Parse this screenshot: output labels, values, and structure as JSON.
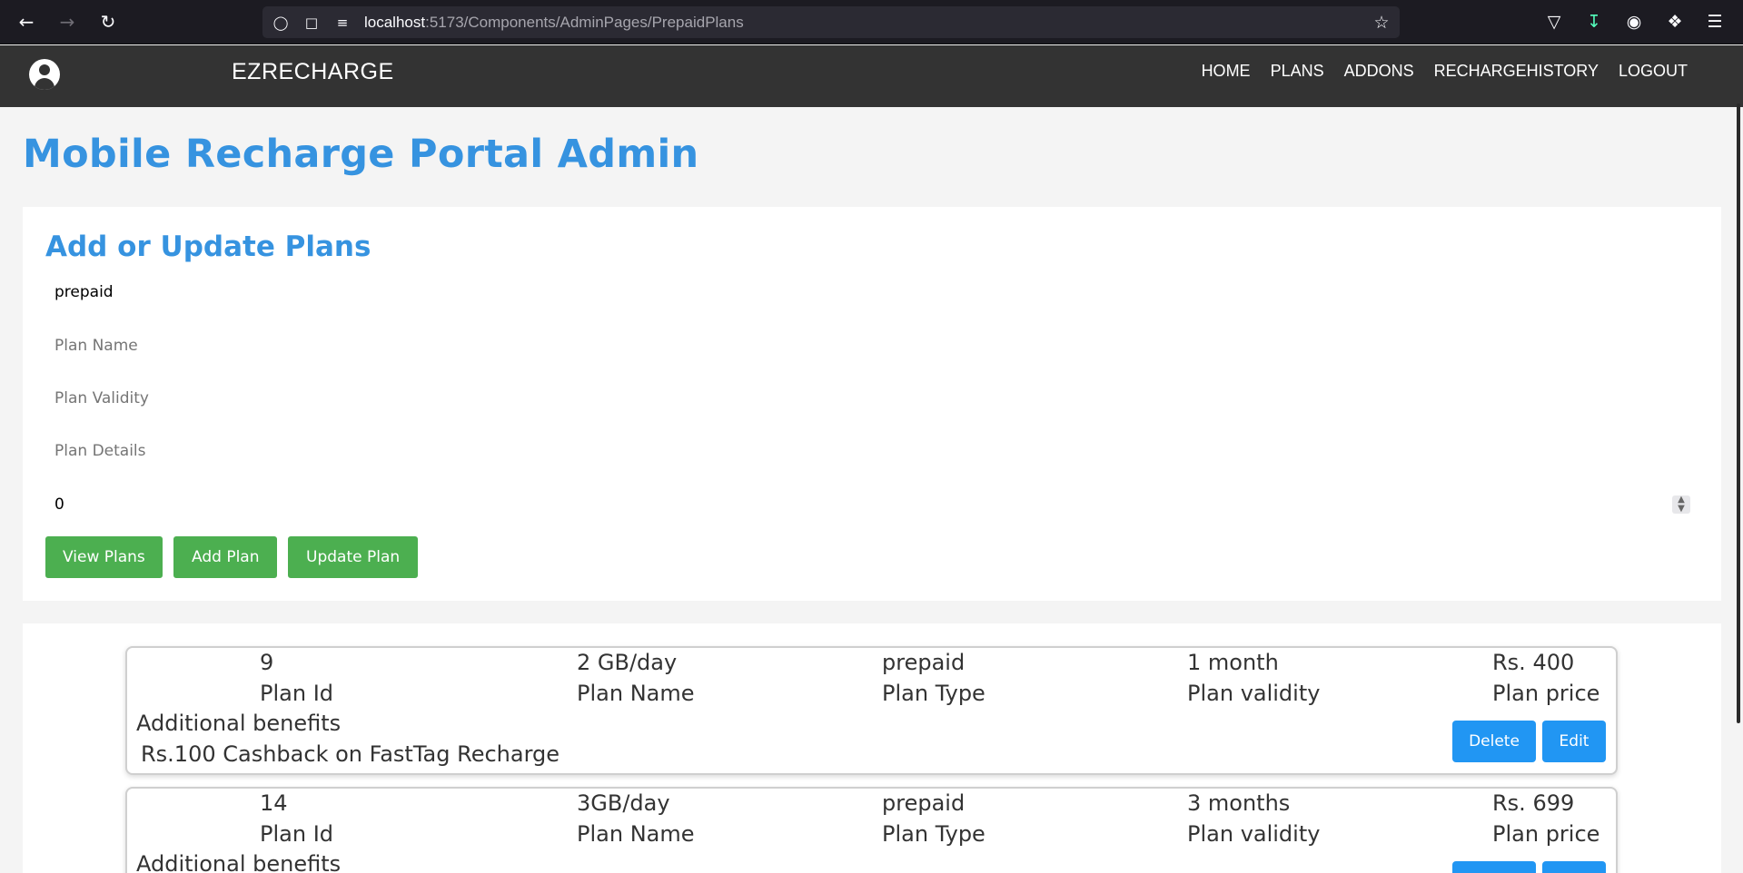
{
  "browser": {
    "url_host": "localhost",
    "url_path": ":5173/Components/AdminPages/PrepaidPlans"
  },
  "navbar": {
    "brand": "EZRECHARGE",
    "links": [
      "HOME",
      "PLANS",
      "ADDONS",
      "RECHARGEHISTORY",
      "LOGOUT"
    ]
  },
  "page": {
    "title": "Mobile Recharge Portal Admin"
  },
  "form": {
    "title": "Add or Update Plans",
    "plan_type_value": "prepaid",
    "plan_name_placeholder": "Plan Name",
    "plan_validity_placeholder": "Plan Validity",
    "plan_details_placeholder": "Plan Details",
    "plan_price_value": "0",
    "buttons": {
      "view": "View Plans",
      "add": "Add Plan",
      "update": "Update Plan"
    }
  },
  "labels": {
    "plan_id": "Plan Id",
    "plan_name": "Plan Name",
    "plan_type": "Plan Type",
    "plan_validity": "Plan validity",
    "plan_price": "Plan price",
    "additional_benefits": "Additional benefits",
    "delete": "Delete",
    "edit": "Edit"
  },
  "plans": [
    {
      "id": "9",
      "name": "2 GB/day",
      "type": "prepaid",
      "validity": "1 month",
      "price": "Rs. 400",
      "benefits": "Rs.100 Cashback on FastTag Recharge"
    },
    {
      "id": "14",
      "name": "3GB/day",
      "type": "prepaid",
      "validity": "3 months",
      "price": "Rs. 699",
      "benefits": ""
    }
  ]
}
